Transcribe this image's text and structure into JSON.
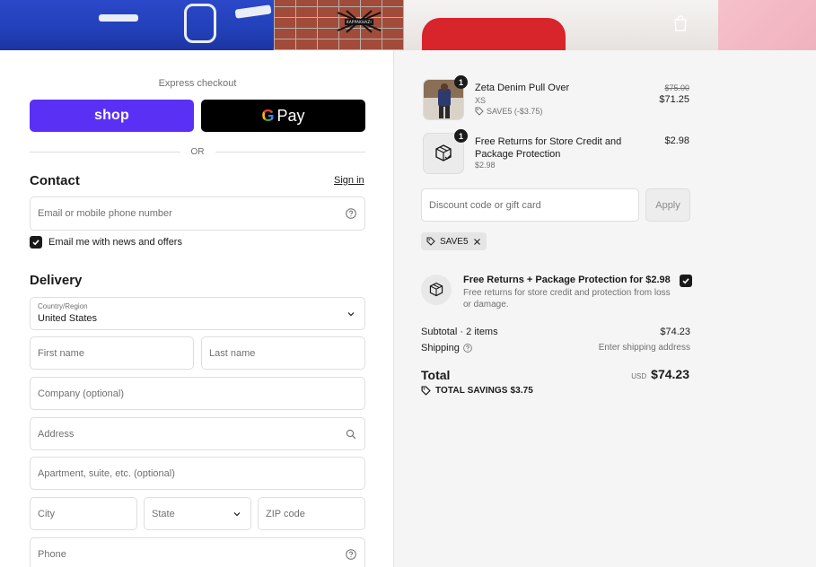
{
  "hero": {
    "logo_text": "KAPPAKHAZI",
    "cart_icon": "shopping-bag-icon"
  },
  "express": {
    "label": "Express checkout",
    "shop_label": "shop",
    "gpay_g": "G",
    "gpay_label": "Pay",
    "or_label": "OR"
  },
  "contact": {
    "title": "Contact",
    "sign_in": "Sign in",
    "email_placeholder": "Email or mobile phone number",
    "email_checkbox_label": "Email me with news and offers",
    "email_checkbox_checked": true
  },
  "delivery": {
    "title": "Delivery",
    "country_label": "Country/Region",
    "country_value": "United States",
    "first_name": "First name",
    "last_name": "Last name",
    "company": "Company (optional)",
    "address": "Address",
    "apartment": "Apartment, suite, etc. (optional)",
    "city": "City",
    "state": "State",
    "zip": "ZIP code",
    "phone": "Phone"
  },
  "order": {
    "items": [
      {
        "name": "Zeta Denim Pull Over",
        "variant": "XS",
        "discount": "SAVE5 (-$3.75)",
        "original_price": "$75.00",
        "price": "$71.25",
        "qty": "1"
      },
      {
        "name": "Free Returns for Store Credit and Package Protection",
        "variant": "$2.98",
        "price": "$2.98",
        "qty": "1"
      }
    ],
    "discount_placeholder": "Discount code or gift card",
    "apply_label": "Apply",
    "applied_code": "SAVE5",
    "protection": {
      "title": "Free Returns + Package Protection for $2.98",
      "description": "Free returns for store credit and protection from loss or damage.",
      "checked": true
    },
    "subtotal_label": "Subtotal · 2 items",
    "subtotal_value": "$74.23",
    "shipping_label": "Shipping",
    "shipping_value": "Enter shipping address",
    "total_label": "Total",
    "currency": "USD",
    "total_value": "$74.23",
    "savings_label": "TOTAL SAVINGS $3.75"
  },
  "colors": {
    "shop_purple": "#5a31f4",
    "gpay_black": "#000000",
    "text": "#1a1a1a",
    "muted": "#707070",
    "summary_bg": "#f5f5f5"
  }
}
